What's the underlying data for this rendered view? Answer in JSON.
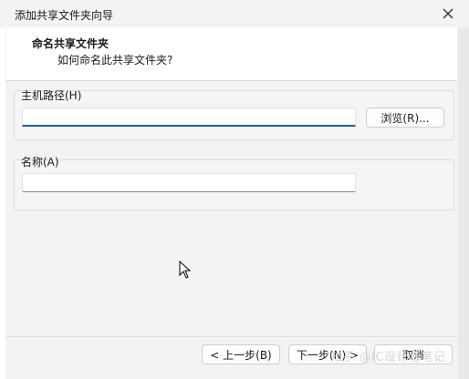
{
  "window": {
    "title": "添加共享文件夹向导",
    "close_icon": "close-icon"
  },
  "header": {
    "title": "命名共享文件夹",
    "subtitle": "如何命名此共享文件夹?"
  },
  "host_path": {
    "label": "主机路径(H)",
    "value": "",
    "browse_label": "浏览(R)..."
  },
  "name": {
    "label": "名称(A)",
    "value": ""
  },
  "footer": {
    "back_label": "< 上一步(B)",
    "next_label": "下一步(N) >",
    "cancel_label": "取消"
  },
  "watermark": "知乎 @IC设计者笔记",
  "colors": {
    "focus_border": "#1f5fa8",
    "window_bg": "#f3f3f3"
  }
}
